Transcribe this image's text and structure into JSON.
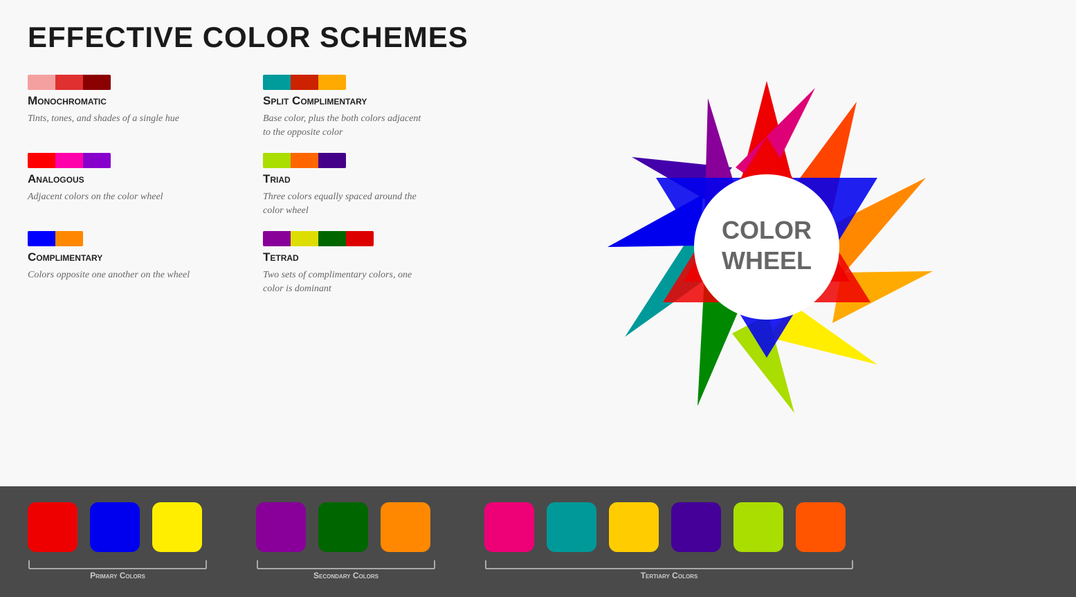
{
  "page": {
    "title": "Effective Color Schemes"
  },
  "schemes": [
    {
      "id": "monochromatic",
      "name": "Monochromatic",
      "desc": "Tints, tones, and shades of a  single hue",
      "swatches": [
        "#f4a0a0",
        "#e03030",
        "#8b0000"
      ]
    },
    {
      "id": "split-complimentary",
      "name": "Split Complimentary",
      "desc": "Base color, plus the both colors adjacent to the opposite color",
      "swatches": [
        "#009b9b",
        "#cc2200",
        "#ffaa00"
      ]
    },
    {
      "id": "analogous",
      "name": "Analogous",
      "desc": "Adjacent colors on the color wheel",
      "swatches": [
        "#ff0000",
        "#ff00aa",
        "#8800cc"
      ]
    },
    {
      "id": "triad",
      "name": "Triad",
      "desc": "Three colors equally spaced around the color wheel",
      "swatches": [
        "#aadd00",
        "#ff6600",
        "#440088"
      ]
    },
    {
      "id": "complimentary",
      "name": "Complimentary",
      "desc": "Colors opposite one another on the wheel",
      "swatches": [
        "#0000ff",
        "#ff8800"
      ]
    },
    {
      "id": "tetrad",
      "name": "Tetrad",
      "desc": "Two sets of complimentary colors, one color is dominant",
      "swatches": [
        "#880099",
        "#dddd00",
        "#006600",
        "#dd0000"
      ]
    }
  ],
  "wheel": {
    "label": "COLOR\nWHEEL"
  },
  "bottom": {
    "primary": {
      "label": "Primary Colors",
      "colors": [
        "#ee0000",
        "#0000ee",
        "#ffee00"
      ]
    },
    "secondary": {
      "label": "Secondary Colors",
      "colors": [
        "#880099",
        "#006600",
        "#ff8800"
      ]
    },
    "tertiary": {
      "label": "Tertiary Colors",
      "colors": [
        "#ee0077",
        "#009999",
        "#ffcc00",
        "#440099",
        "#aadd00",
        "#ff5500"
      ]
    }
  }
}
